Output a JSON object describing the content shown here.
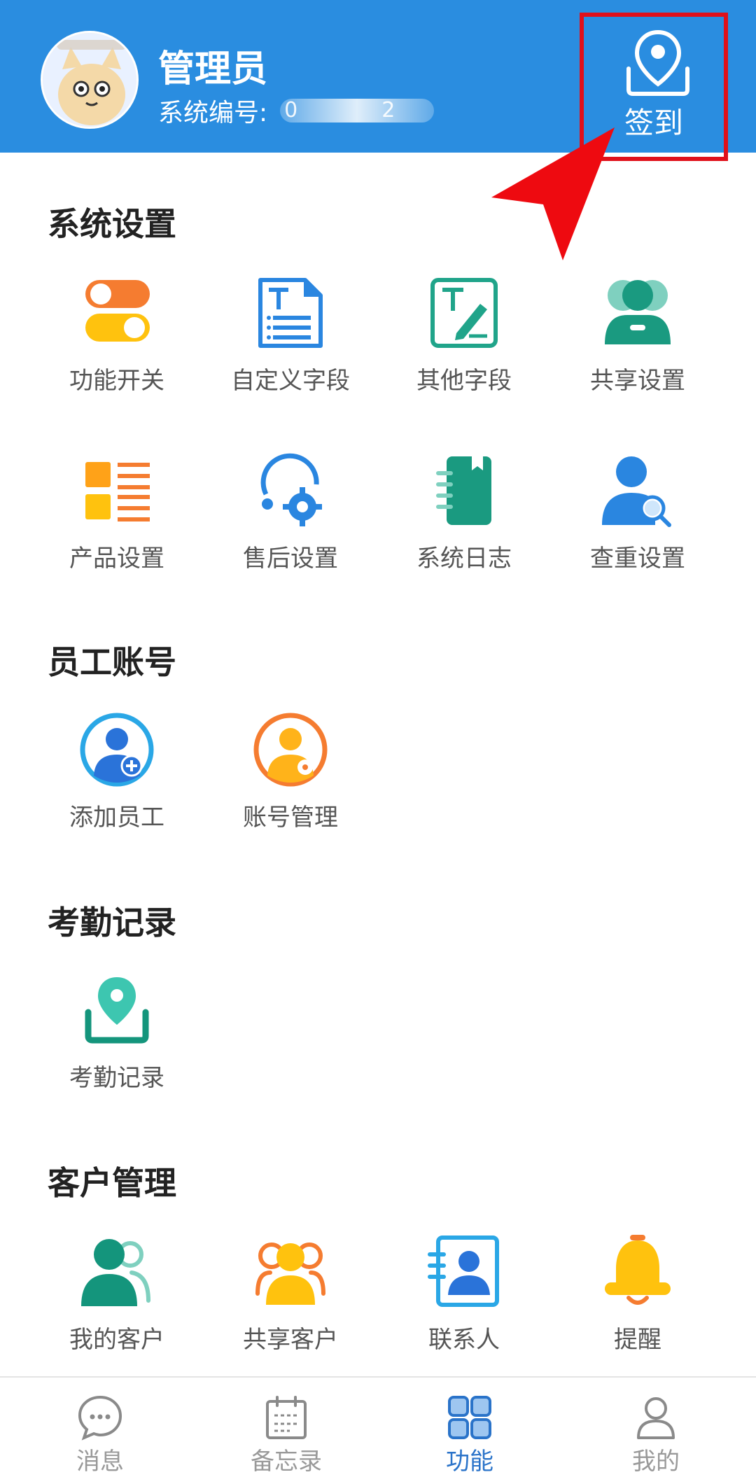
{
  "header": {
    "user_name": "管理员",
    "system_id_label": "系统编号:",
    "system_id_value": "02",
    "checkin_label": "签到",
    "background_color": "#2a8de0",
    "highlight_color": "#e0101a"
  },
  "sections": [
    {
      "title": "系统设置",
      "items": [
        {
          "label": "功能开关",
          "icon": "toggle-switch-icon"
        },
        {
          "label": "自定义字段",
          "icon": "text-document-icon"
        },
        {
          "label": "其他字段",
          "icon": "text-edit-icon"
        },
        {
          "label": "共享设置",
          "icon": "shared-users-icon"
        },
        {
          "label": "产品设置",
          "icon": "product-list-icon"
        },
        {
          "label": "售后设置",
          "icon": "after-sales-gear-icon"
        },
        {
          "label": "系统日志",
          "icon": "log-notebook-icon"
        },
        {
          "label": "查重设置",
          "icon": "user-search-icon"
        }
      ]
    },
    {
      "title": "员工账号",
      "items": [
        {
          "label": "添加员工",
          "icon": "add-user-icon"
        },
        {
          "label": "账号管理",
          "icon": "account-gear-icon"
        }
      ]
    },
    {
      "title": "考勤记录",
      "items": [
        {
          "label": "考勤记录",
          "icon": "location-pin-icon"
        }
      ]
    },
    {
      "title": "客户管理",
      "items": [
        {
          "label": "我的客户",
          "icon": "my-customers-icon"
        },
        {
          "label": "共享客户",
          "icon": "shared-customers-icon"
        },
        {
          "label": "联系人",
          "icon": "contact-card-icon"
        },
        {
          "label": "提醒",
          "icon": "bell-icon"
        }
      ]
    }
  ],
  "bottom_nav": [
    {
      "label": "消息",
      "icon": "chat-bubble-icon",
      "active": false
    },
    {
      "label": "备忘录",
      "icon": "calendar-icon",
      "active": false
    },
    {
      "label": "功能",
      "icon": "grid-icon",
      "active": true
    },
    {
      "label": "我的",
      "icon": "person-icon",
      "active": false
    }
  ]
}
